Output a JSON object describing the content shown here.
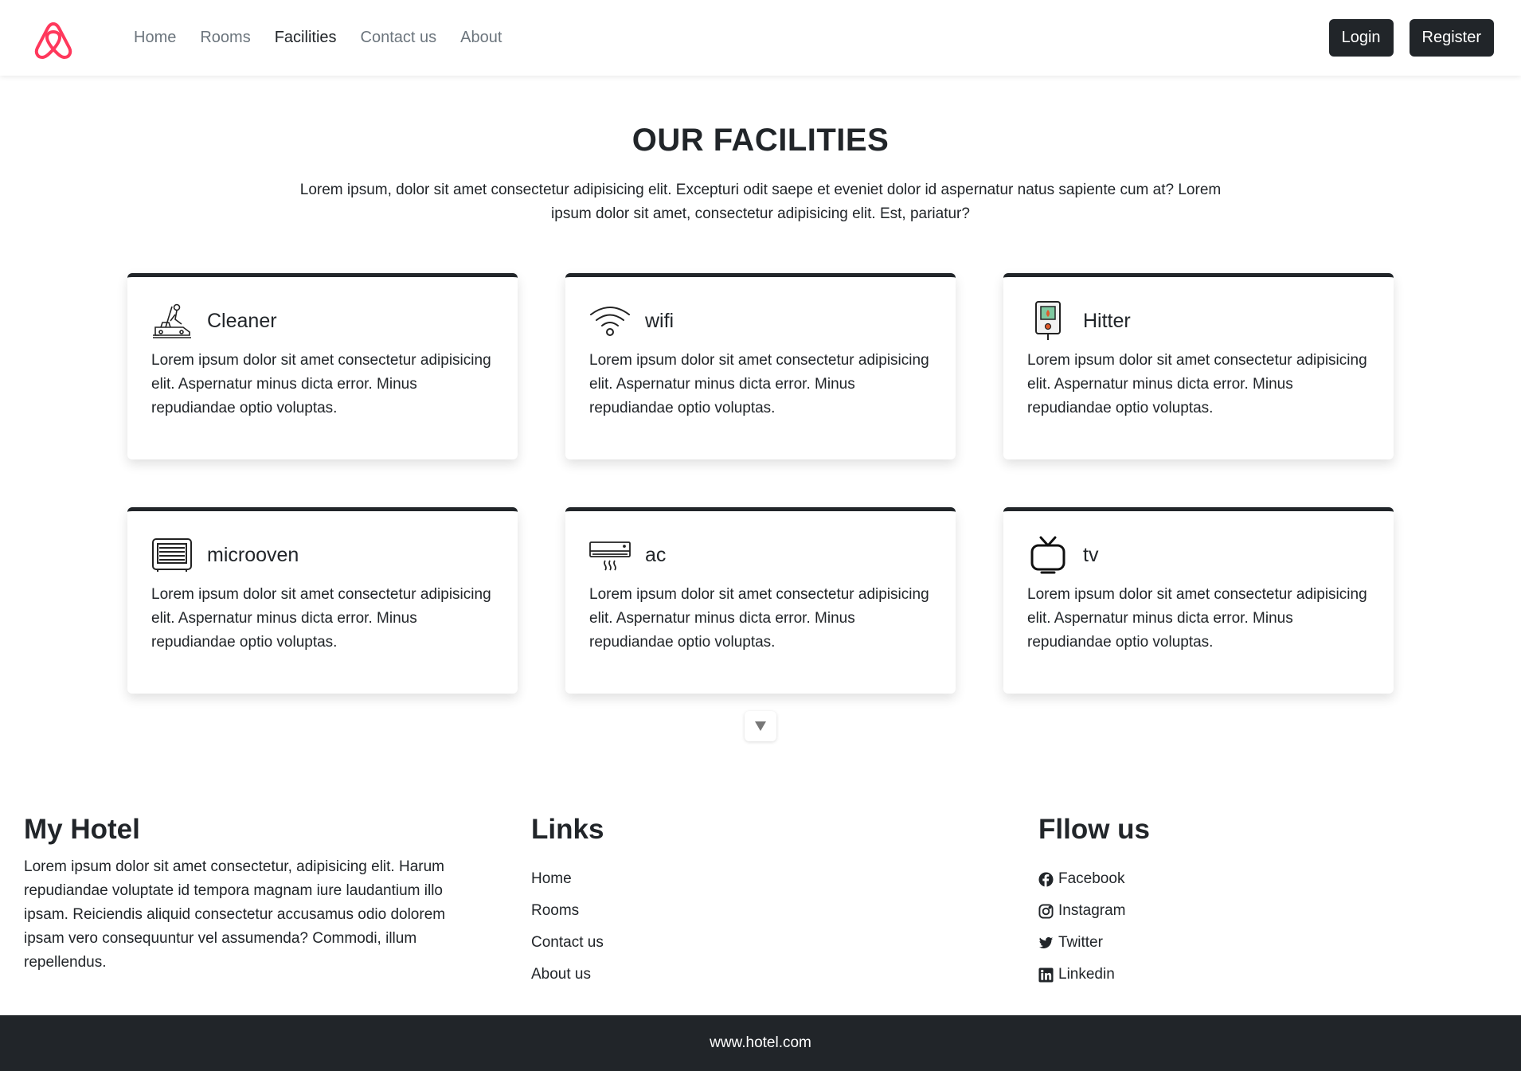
{
  "nav": {
    "brand_icon": "airbnb-logo-icon",
    "brand_color": "#FF385C",
    "links": [
      {
        "label": "Home",
        "active": false
      },
      {
        "label": "Rooms",
        "active": false
      },
      {
        "label": "Facilities",
        "active": true
      },
      {
        "label": "Contact us",
        "active": false
      },
      {
        "label": "About",
        "active": false
      }
    ],
    "login_label": "Login",
    "register_label": "Register"
  },
  "facilities": {
    "title": "OUR FACILITIES",
    "description": "Lorem ipsum, dolor sit amet consectetur adipisicing elit. Excepturi odit saepe et eveniet dolor id aspernatur natus sapiente cum at? Lorem ipsum dolor sit amet, consectetur adipisicing elit. Est, pariatur?",
    "cards": [
      {
        "title": "Cleaner",
        "icon": "cleaner-icon",
        "text": "Lorem ipsum dolor sit amet consectetur adipisicing elit. Aspernatur minus dicta error. Minus repudiandae optio voluptas."
      },
      {
        "title": "wifi",
        "icon": "wifi-icon",
        "text": "Lorem ipsum dolor sit amet consectetur adipisicing elit. Aspernatur minus dicta error. Minus repudiandae optio voluptas."
      },
      {
        "title": "Hitter",
        "icon": "heater-icon",
        "text": "Lorem ipsum dolor sit amet consectetur adipisicing elit. Aspernatur minus dicta error. Minus repudiandae optio voluptas."
      },
      {
        "title": "microoven",
        "icon": "microwave-icon",
        "text": "Lorem ipsum dolor sit amet consectetur adipisicing elit. Aspernatur minus dicta error. Minus repudiandae optio voluptas."
      },
      {
        "title": "ac",
        "icon": "air-conditioner-icon",
        "text": "Lorem ipsum dolor sit amet consectetur adipisicing elit. Aspernatur minus dicta error. Minus repudiandae optio voluptas."
      },
      {
        "title": "tv",
        "icon": "tv-icon",
        "text": "Lorem ipsum dolor sit amet consectetur adipisicing elit. Aspernatur minus dicta error. Minus repudiandae optio voluptas."
      }
    ],
    "scroll_icon": "chevron-down-icon"
  },
  "footer": {
    "about": {
      "title": "My Hotel",
      "text": "Lorem ipsum dolor sit amet consectetur, adipisicing elit. Harum repudiandae voluptate id tempora magnam iure laudantium illo ipsam. Reiciendis aliquid consectetur accusamus odio dolorem ipsam vero consequuntur vel assumenda? Commodi, illum repellendus."
    },
    "links": {
      "title": "Links",
      "items": [
        "Home",
        "Rooms",
        "Contact us",
        "About us"
      ]
    },
    "follow": {
      "title": "Fllow us",
      "items": [
        {
          "label": "Facebook",
          "icon": "facebook-icon"
        },
        {
          "label": "Instagram",
          "icon": "instagram-icon"
        },
        {
          "label": "Twitter",
          "icon": "twitter-icon"
        },
        {
          "label": "Linkedin",
          "icon": "linkedin-icon"
        }
      ]
    },
    "bottom_text": "www.hotel.com"
  }
}
